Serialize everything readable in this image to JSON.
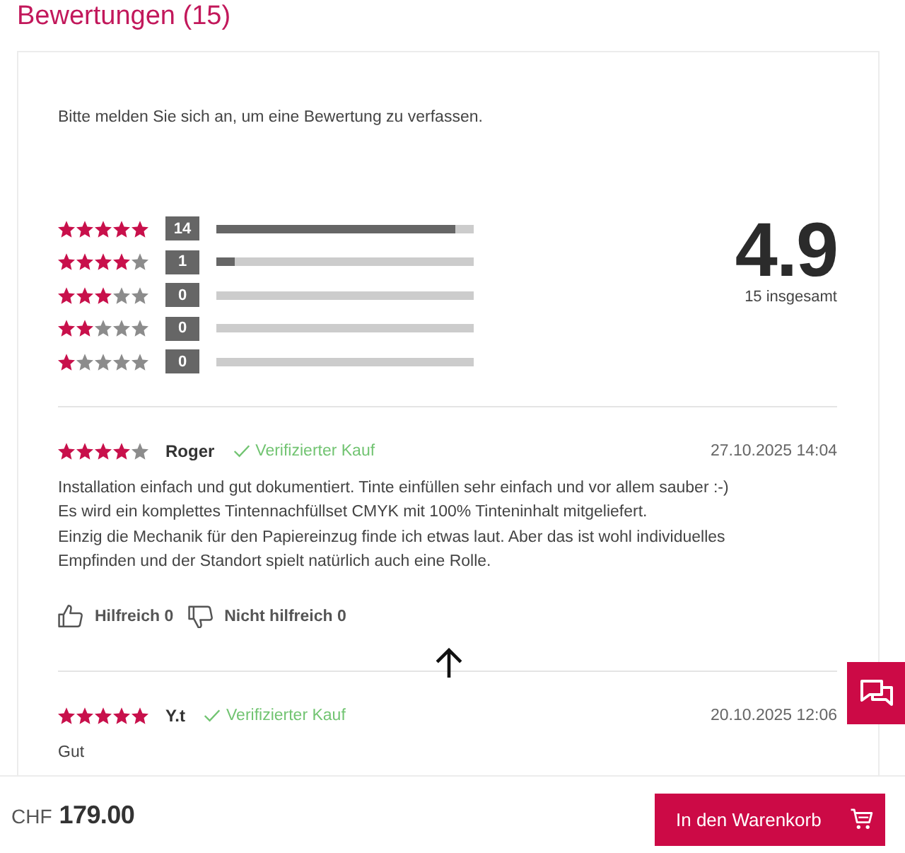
{
  "title": "Bewertungen (15)",
  "reviews_panel": {
    "login_hint": "Bitte melden Sie sich an, um eine Bewertung zu verfassen.",
    "distribution": [
      {
        "stars": 5,
        "count": "14",
        "level": 0.93
      },
      {
        "stars": 4,
        "count": "1",
        "level": 0.07
      },
      {
        "stars": 3,
        "count": "0"
      },
      {
        "stars": 2,
        "count": "0"
      },
      {
        "stars": 1,
        "count": "0"
      }
    ],
    "average": "4.9",
    "total": "15 insgesamt",
    "reviews": [
      {
        "stars": 4,
        "author": "Roger",
        "verified": "Verifizierter Kauf",
        "date": "27.10.2025 14:04",
        "text": "Installation einfach und gut dokumentiert. Tinte einfüllen sehr einfach und vor allem sauber :-)\nEs wird ein komplettes Tintennachfüllset CMYK mit 100% Tinteninhalt mitgeliefert.\nEinzig die Mechanik für den Papiereinzug finde ich etwas laut. Aber das ist wohl individuelles\nEmpfinden und der Standort spielt natürlich auch eine Rolle.",
        "helpful": {
          "label": "Hilfreich",
          "count": "0"
        },
        "not_helpful": {
          "label": "Nicht hilfreich",
          "count": "0"
        }
      },
      {
        "stars": 5,
        "author": "Y.t",
        "verified": "Verifizierter Kauf",
        "date": "20.10.2025 12:06",
        "text": "Gut"
      }
    ]
  },
  "footer": {
    "currency": "CHF",
    "price": "179.00",
    "cart_button": "In den Warenkorb"
  }
}
